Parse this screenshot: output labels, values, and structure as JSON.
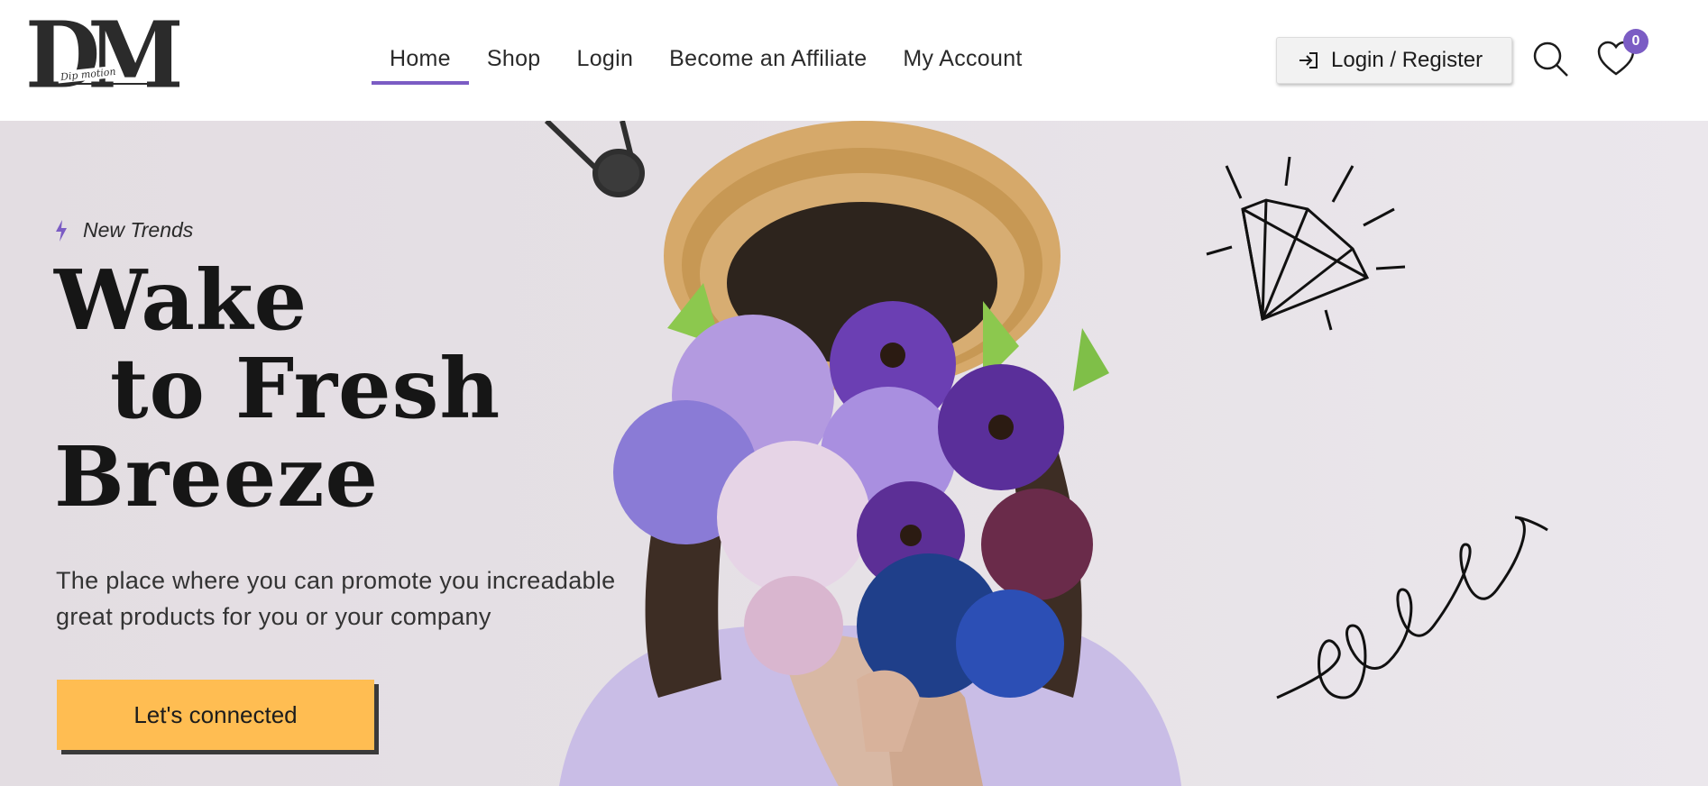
{
  "header": {
    "logo_text": "DM",
    "logo_script": "Dip motion",
    "nav": [
      {
        "label": "Home",
        "active": true
      },
      {
        "label": "Shop",
        "active": false
      },
      {
        "label": "Login",
        "active": false
      },
      {
        "label": "Become an Affiliate",
        "active": false
      },
      {
        "label": "My Account",
        "active": false
      }
    ],
    "login_register_label": "Login / Register",
    "wishlist_count": "0",
    "icons": [
      "login-arrow-icon",
      "search-icon",
      "heart-icon"
    ]
  },
  "hero": {
    "tagline": "New Trends",
    "headline_line1": "Wake",
    "headline_line2": "to Fresh",
    "headline_line3": "Breeze",
    "subtext_line1": "The place where you can promote you increadable",
    "subtext_line2": "great products for you or your company",
    "cta_label": "Let's connected"
  },
  "colors": {
    "accent": "#7b5cc4",
    "cta": "#ffbd52",
    "hero_bg": "#e5e0e5",
    "text": "#1c1c1c"
  }
}
